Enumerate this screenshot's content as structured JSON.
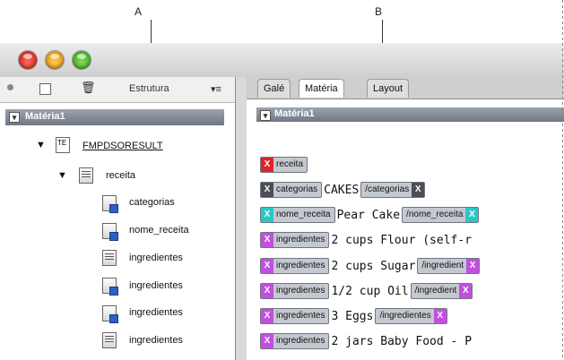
{
  "callouts": {
    "a": "A",
    "b": "B"
  },
  "toolbar": {
    "structure_label": "Estrutura",
    "menu_glyph": "▾≡"
  },
  "tree": {
    "root_label": "Matéria1",
    "fmp_label": "FMPDSORESULT",
    "receita_label": "receita",
    "items": [
      "categorias",
      "nome_receita",
      "ingredientes",
      "ingredientes",
      "ingredientes",
      "ingredientes"
    ]
  },
  "tabs": [
    "Galé",
    "Matéria",
    "Layout"
  ],
  "editor": {
    "title": "Matéria1",
    "root_tag": "receita",
    "rows": [
      {
        "tag": "categorias",
        "text": "CAKES",
        "end": "/categorias",
        "color": "#4a4f56"
      },
      {
        "tag": "nome_receita",
        "text": "Pear Cake",
        "end": "/nome_receita",
        "color": "#2bc6c8"
      },
      {
        "tag": "ingredientes",
        "text": "2 cups Flour (self-r",
        "end": "",
        "color": "#c24fe0"
      },
      {
        "tag": "ingredientes",
        "text": "2 cups Sugar",
        "end": "/ingredient",
        "color": "#c24fe0"
      },
      {
        "tag": "ingredientes",
        "text": "1/2 cup Oil",
        "end": "/ingredient",
        "color": "#c24fe0"
      },
      {
        "tag": "ingredientes",
        "text": "3 Eggs",
        "end": "/ingredientes",
        "color": "#c24fe0"
      },
      {
        "tag": "ingredientes",
        "text": "2 jars Baby Food - P",
        "end": "",
        "color": "#c24fe0"
      }
    ],
    "root_color": "#e0242a"
  }
}
